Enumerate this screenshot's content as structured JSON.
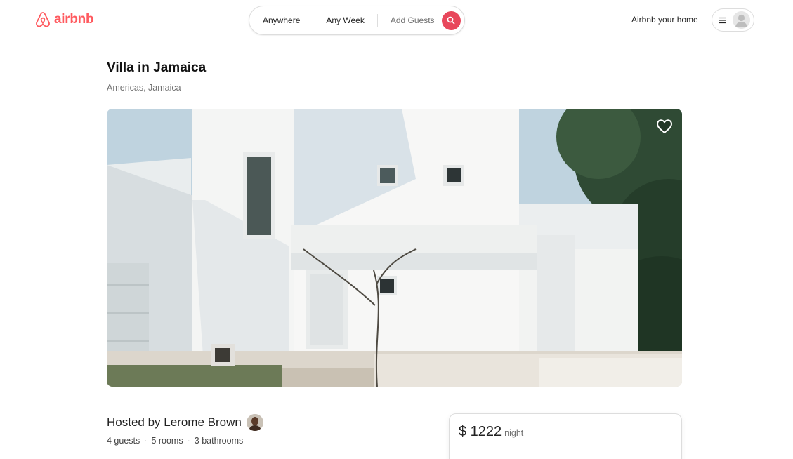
{
  "header": {
    "logo_text": "airbnb",
    "search": {
      "location": "Anywhere",
      "dates": "Any Week",
      "guests": "Add Guests"
    },
    "host_link": "Airbnb your home"
  },
  "listing": {
    "title": "Villa in Jamaica",
    "location": "Americas, Jamaica",
    "hosted_by": "Hosted by Lerome Brown",
    "specs": [
      "4 guests",
      "5 rooms",
      "3 bathrooms"
    ]
  },
  "booking": {
    "price": "$ 1222",
    "per": "night"
  },
  "colors": {
    "brand": "#ff5a5f",
    "search_button": "#e8475b"
  },
  "icons": [
    "airbnb-logo-icon",
    "search-icon",
    "menu-icon",
    "user-avatar-icon",
    "heart-icon"
  ]
}
